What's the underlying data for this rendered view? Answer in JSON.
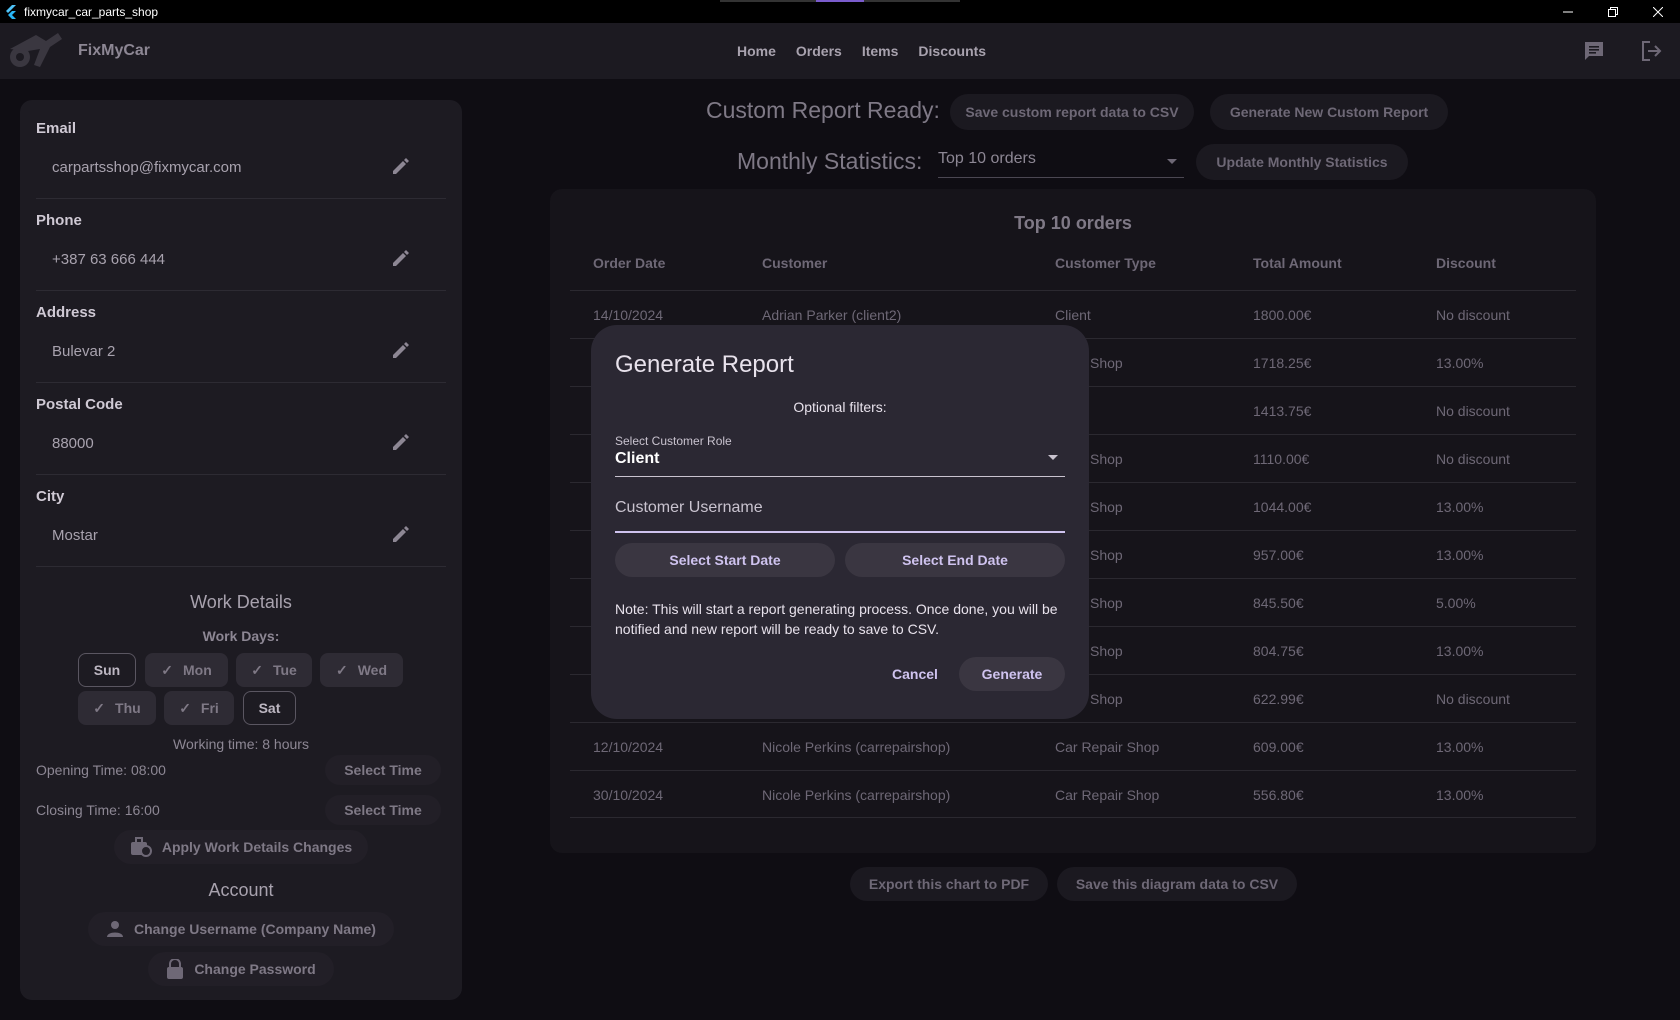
{
  "window": {
    "title": "fixmycar_car_parts_shop"
  },
  "appbar": {
    "brand": "FixMyCar",
    "nav": [
      "Home",
      "Orders",
      "Items",
      "Discounts"
    ]
  },
  "profile": {
    "fields": [
      {
        "label": "Email",
        "value": "carpartsshop@fixmycar.com"
      },
      {
        "label": "Phone",
        "value": "+387 63 666 444"
      },
      {
        "label": "Address",
        "value": "Bulevar 2"
      },
      {
        "label": "Postal Code",
        "value": "88000"
      },
      {
        "label": "City",
        "value": "Mostar"
      }
    ],
    "work_details_title": "Work Details",
    "work_days_label": "Work Days:",
    "days": [
      {
        "label": "Sun",
        "selected": false
      },
      {
        "label": "Mon",
        "selected": true
      },
      {
        "label": "Tue",
        "selected": true
      },
      {
        "label": "Wed",
        "selected": true
      },
      {
        "label": "Thu",
        "selected": true
      },
      {
        "label": "Fri",
        "selected": true
      },
      {
        "label": "Sat",
        "selected": false
      }
    ],
    "working_time": "Working time: 8 hours",
    "opening_time": "Opening Time: 08:00",
    "closing_time": "Closing Time: 16:00",
    "select_time_label": "Select Time",
    "apply_label": "Apply Work Details Changes",
    "account_title": "Account",
    "change_username_label": "Change Username (Company Name)",
    "change_password_label": "Change Password"
  },
  "report": {
    "ready_label": "Custom Report Ready:",
    "save_csv_label": "Save custom report data to CSV",
    "generate_new_label": "Generate New Custom Report",
    "monthly_label": "Monthly Statistics:",
    "monthly_select": "Top 10 orders",
    "update_label": "Update Monthly Statistics"
  },
  "table": {
    "title": "Top 10 orders",
    "headers": [
      "Order Date",
      "Customer",
      "Customer Type",
      "Total Amount",
      "Discount"
    ],
    "rows": [
      [
        "14/10/2024",
        "Adrian Parker (client2)",
        "Client",
        "1800.00€",
        "No discount"
      ],
      [
        "",
        "",
        "epair Shop",
        "1718.25€",
        "13.00%"
      ],
      [
        "",
        "",
        "t",
        "1413.75€",
        "No discount"
      ],
      [
        "",
        "",
        "epair Shop",
        "1110.00€",
        "No discount"
      ],
      [
        "",
        "",
        "epair Shop",
        "1044.00€",
        "13.00%"
      ],
      [
        "",
        "",
        "epair Shop",
        "957.00€",
        "13.00%"
      ],
      [
        "",
        "",
        "epair Shop",
        "845.50€",
        "5.00%"
      ],
      [
        "",
        "",
        "epair Shop",
        "804.75€",
        "13.00%"
      ],
      [
        "",
        "",
        "epair Shop",
        "622.99€",
        "No discount"
      ],
      [
        "12/10/2024",
        "Nicole Perkins (carrepairshop)",
        "Car Repair Shop",
        "609.00€",
        "13.00%"
      ],
      [
        "30/10/2024",
        "Nicole Perkins (carrepairshop)",
        "Car Repair Shop",
        "556.80€",
        "13.00%"
      ]
    ]
  },
  "bottom": {
    "export_pdf": "Export this chart to PDF",
    "save_csv": "Save this diagram data to CSV"
  },
  "dialog": {
    "title": "Generate Report",
    "subtitle": "Optional filters:",
    "role_label": "Select Customer Role",
    "role_value": "Client",
    "username_placeholder": "Customer Username",
    "start_date": "Select Start Date",
    "end_date": "Select End Date",
    "note": "Note: This will start a report generating process. Once done, you will be notified and new report will be ready to save to CSV.",
    "cancel": "Cancel",
    "generate": "Generate"
  },
  "colors": {
    "accent": "#cfc3ef",
    "background": "#0f0d13",
    "dialog": "#2b2833"
  }
}
